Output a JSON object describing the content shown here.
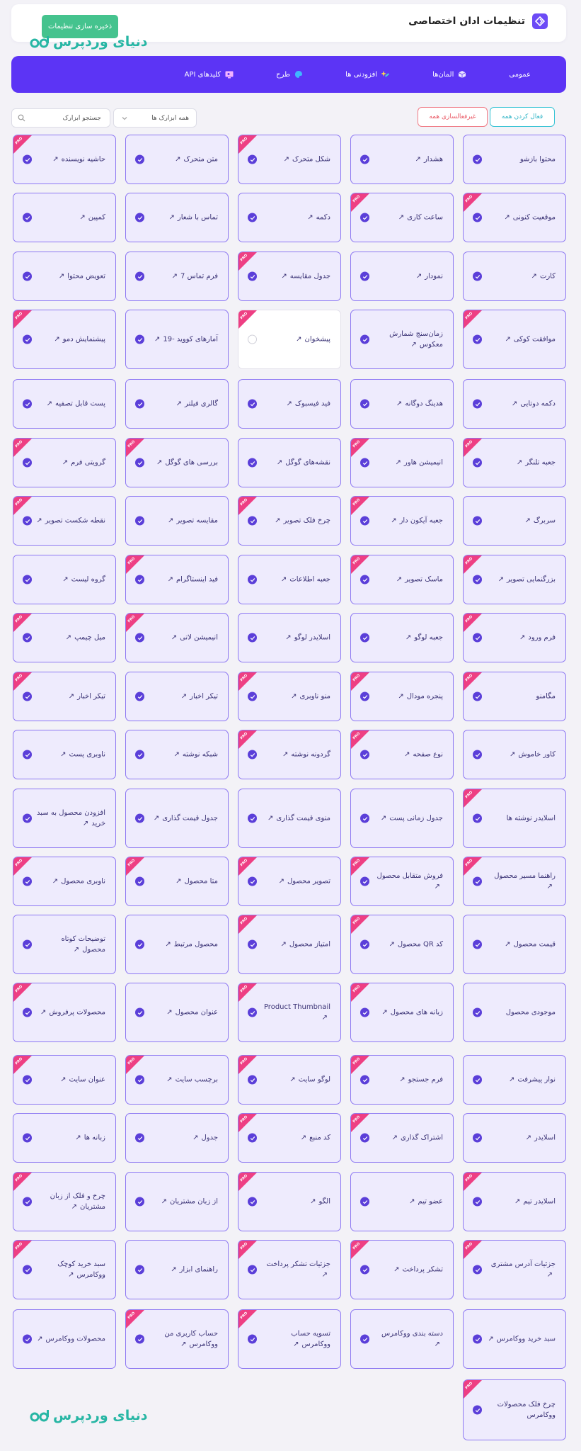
{
  "header": {
    "title": "تنظیمات ادان اختصاصی",
    "save_label": "ذخیره سازی تنظیمات",
    "logo_text": "دنیای وردپرس"
  },
  "nav": {
    "items": [
      {
        "label": "عمومی",
        "icon": "none"
      },
      {
        "label": "المان‌ها",
        "icon": "cube-icon"
      },
      {
        "label": "افزودنی ها",
        "icon": "sparkles-icon"
      },
      {
        "label": "طرح",
        "icon": "palette-icon"
      },
      {
        "label": "کلیدهای API",
        "icon": "key-screen-icon"
      }
    ]
  },
  "toolbar": {
    "enable_all": "فعال کردن همه",
    "disable_all": "غیرفعالسازی همه",
    "filter_selected": "همه ابزارک ها",
    "search_placeholder": "جستجو ابزارک"
  },
  "badge_text": "PRO",
  "colors": {
    "accent": "#5c34f5",
    "save": "#45c38e",
    "pro": "#ee3f83",
    "logo": "#27b6a4"
  },
  "widgets": [
    [
      {
        "label": "محتوا بازشو",
        "ext": false,
        "pro": false,
        "on": true
      },
      {
        "label": "هشدار",
        "ext": true,
        "pro": false,
        "on": true
      },
      {
        "label": "شکل متحرک",
        "ext": true,
        "pro": true,
        "on": true
      },
      {
        "label": "متن متحرک",
        "ext": true,
        "pro": false,
        "on": true
      },
      {
        "label": "حاشیه نویسنده",
        "ext": true,
        "pro": true,
        "on": true
      }
    ],
    [
      {
        "label": "موقعیت کنونی",
        "ext": true,
        "pro": true,
        "on": true
      },
      {
        "label": "ساعت کاری",
        "ext": true,
        "pro": true,
        "on": true
      },
      {
        "label": "دکمه",
        "ext": true,
        "pro": false,
        "on": true
      },
      {
        "label": "تماس با شعار",
        "ext": true,
        "pro": false,
        "on": true
      },
      {
        "label": "کمپین",
        "ext": true,
        "pro": false,
        "on": true
      }
    ],
    [
      {
        "label": "کارت",
        "ext": true,
        "pro": false,
        "on": true
      },
      {
        "label": "نمودار",
        "ext": true,
        "pro": false,
        "on": true
      },
      {
        "label": "جدول مقایسه",
        "ext": true,
        "pro": true,
        "on": true
      },
      {
        "label": "فرم تماس 7",
        "ext": true,
        "pro": false,
        "on": true
      },
      {
        "label": "تعویض محتوا",
        "ext": true,
        "pro": false,
        "on": true
      }
    ],
    [
      {
        "label": "موافقت کوکی",
        "ext": true,
        "pro": true,
        "on": true
      },
      {
        "label": "زمان‌سنج شمارش معکوس",
        "ext": true,
        "pro": false,
        "on": true
      },
      {
        "label": "پیشخوان",
        "ext": true,
        "pro": true,
        "on": false
      },
      {
        "label": "آمارهای کووید -19",
        "ext": true,
        "pro": false,
        "on": true
      },
      {
        "label": "پیشنمایش دمو",
        "ext": true,
        "pro": true,
        "on": true
      }
    ],
    [
      {
        "label": "دکمه دوتایی",
        "ext": true,
        "pro": false,
        "on": true
      },
      {
        "label": "هدینگ دوگانه",
        "ext": true,
        "pro": false,
        "on": true
      },
      {
        "label": "فید فیسبوک",
        "ext": true,
        "pro": false,
        "on": true
      },
      {
        "label": "گالری فیلتر",
        "ext": true,
        "pro": false,
        "on": true
      },
      {
        "label": "پست قابل تصفیه",
        "ext": true,
        "pro": false,
        "on": true
      }
    ],
    [
      {
        "label": "جعبه تلنگر",
        "ext": true,
        "pro": true,
        "on": true
      },
      {
        "label": "انیمیشن هاور",
        "ext": true,
        "pro": true,
        "on": true
      },
      {
        "label": "نقشه‌های گوگل",
        "ext": true,
        "pro": false,
        "on": true
      },
      {
        "label": "بررسی های گوگل",
        "ext": true,
        "pro": true,
        "on": true
      },
      {
        "label": "گرویتی فرم",
        "ext": true,
        "pro": true,
        "on": true
      }
    ],
    [
      {
        "label": "سربرگ",
        "ext": true,
        "pro": false,
        "on": true
      },
      {
        "label": "جعبه آیکون دار",
        "ext": true,
        "pro": true,
        "on": true
      },
      {
        "label": "چرخ فلک تصویر",
        "ext": true,
        "pro": true,
        "on": true
      },
      {
        "label": "مقایسه تصویر",
        "ext": true,
        "pro": false,
        "on": true
      },
      {
        "label": "نقطه شکست تصویر",
        "ext": true,
        "pro": true,
        "on": true
      }
    ],
    [
      {
        "label": "بزرگنمایی تصویر",
        "ext": true,
        "pro": true,
        "on": true
      },
      {
        "label": "ماسک تصویر",
        "ext": true,
        "pro": true,
        "on": true
      },
      {
        "label": "جعبه اطلاعات",
        "ext": true,
        "pro": false,
        "on": true
      },
      {
        "label": "فید اینستاگرام",
        "ext": true,
        "pro": true,
        "on": true
      },
      {
        "label": "گروه لیست",
        "ext": true,
        "pro": false,
        "on": true
      }
    ],
    [
      {
        "label": "فرم ورود",
        "ext": true,
        "pro": true,
        "on": true
      },
      {
        "label": "جعبه لوگو",
        "ext": true,
        "pro": false,
        "on": true
      },
      {
        "label": "اسلایدر لوگو",
        "ext": true,
        "pro": false,
        "on": true
      },
      {
        "label": "انیمیشن لاتی",
        "ext": true,
        "pro": true,
        "on": true
      },
      {
        "label": "میل چیمپ",
        "ext": true,
        "pro": true,
        "on": true
      }
    ],
    [
      {
        "label": "مگامنو",
        "ext": false,
        "pro": true,
        "on": true
      },
      {
        "label": "پنجره مودال",
        "ext": true,
        "pro": true,
        "on": true
      },
      {
        "label": "منو ناوبری",
        "ext": true,
        "pro": true,
        "on": true
      },
      {
        "label": "تیکر اخبار",
        "ext": true,
        "pro": false,
        "on": true
      },
      {
        "label": "تیکر اخبار",
        "ext": true,
        "pro": true,
        "on": true
      }
    ],
    [
      {
        "label": "کاور خاموش",
        "ext": true,
        "pro": false,
        "on": true
      },
      {
        "label": "نوع صفحه",
        "ext": true,
        "pro": true,
        "on": true
      },
      {
        "label": "گردونه نوشته",
        "ext": true,
        "pro": true,
        "on": true
      },
      {
        "label": "شبکه نوشته",
        "ext": true,
        "pro": false,
        "on": true
      },
      {
        "label": "ناوبری پست",
        "ext": true,
        "pro": false,
        "on": true
      }
    ],
    [
      {
        "label": "اسلایدر نوشته ها",
        "ext": false,
        "pro": true,
        "on": true
      },
      {
        "label": "جدول زمانی پست",
        "ext": true,
        "pro": false,
        "on": true
      },
      {
        "label": "منوی قیمت گذاری",
        "ext": true,
        "pro": false,
        "on": true
      },
      {
        "label": "جدول قیمت گذاری",
        "ext": true,
        "pro": false,
        "on": true
      },
      {
        "label": "افزودن محصول به سبد خرید",
        "ext": true,
        "pro": false,
        "on": true
      }
    ],
    [
      {
        "label": "راهنما مسیر محصول",
        "ext": true,
        "pro": true,
        "on": true
      },
      {
        "label": "فروش متقابل محصول",
        "ext": true,
        "pro": true,
        "on": true
      },
      {
        "label": "تصویر محصول",
        "ext": true,
        "pro": true,
        "on": true
      },
      {
        "label": "متا محصول",
        "ext": true,
        "pro": true,
        "on": true
      },
      {
        "label": "ناوبری محصول",
        "ext": true,
        "pro": true,
        "on": true
      }
    ],
    [
      {
        "label": "قیمت محصول",
        "ext": true,
        "pro": false,
        "on": true
      },
      {
        "label": "کد QR محصول",
        "ext": true,
        "pro": true,
        "on": true
      },
      {
        "label": "امتیاز محصول",
        "ext": true,
        "pro": true,
        "on": true
      },
      {
        "label": "محصول مرتبط",
        "ext": true,
        "pro": false,
        "on": true
      },
      {
        "label": "توضیحات کوتاه محصول",
        "ext": true,
        "pro": false,
        "on": true
      }
    ],
    [
      {
        "label": "موجودی محصول",
        "ext": false,
        "pro": false,
        "on": true
      },
      {
        "label": "زبانه های محصول",
        "ext": true,
        "pro": true,
        "on": true
      },
      {
        "label": "Product Thumbnail",
        "ext": true,
        "pro": true,
        "on": true
      },
      {
        "label": "عنوان محصول",
        "ext": true,
        "pro": false,
        "on": true
      },
      {
        "label": "محصولات پرفروش",
        "ext": true,
        "pro": true,
        "on": true
      }
    ],
    [
      {
        "label": "نوار پیشرفت",
        "ext": true,
        "pro": false,
        "on": true
      },
      {
        "label": "فرم جستجو",
        "ext": true,
        "pro": true,
        "on": true
      },
      {
        "label": "لوگو سایت",
        "ext": true,
        "pro": true,
        "on": true
      },
      {
        "label": "برچسب سایت",
        "ext": true,
        "pro": true,
        "on": true
      },
      {
        "label": "عنوان سایت",
        "ext": true,
        "pro": true,
        "on": true
      }
    ],
    [
      {
        "label": "اسلایدر",
        "ext": true,
        "pro": false,
        "on": true
      },
      {
        "label": "اشتراک گذاری",
        "ext": true,
        "pro": true,
        "on": true
      },
      {
        "label": "کد منبع",
        "ext": true,
        "pro": true,
        "on": true
      },
      {
        "label": "جدول",
        "ext": true,
        "pro": false,
        "on": true
      },
      {
        "label": "زبانه ها",
        "ext": true,
        "pro": false,
        "on": true
      }
    ],
    [
      {
        "label": "اسلایدر تیم",
        "ext": true,
        "pro": true,
        "on": true
      },
      {
        "label": "عضو تیم",
        "ext": true,
        "pro": false,
        "on": true
      },
      {
        "label": "الگو",
        "ext": true,
        "pro": true,
        "on": true
      },
      {
        "label": "از زبان مشتریان",
        "ext": true,
        "pro": false,
        "on": true
      },
      {
        "label": "چرخ و فلک از زبان مشتریان",
        "ext": true,
        "pro": true,
        "on": true
      }
    ],
    [
      {
        "label": "جزئیات آدرس مشتری",
        "ext": true,
        "pro": true,
        "on": true
      },
      {
        "label": "تشکر پرداخت",
        "ext": true,
        "pro": true,
        "on": true
      },
      {
        "label": "جزئیات تشکر پرداخت",
        "ext": true,
        "pro": true,
        "on": true
      },
      {
        "label": "راهنمای ابزار",
        "ext": true,
        "pro": false,
        "on": true
      },
      {
        "label": "سبد خرید کوچک ووکامرس",
        "ext": true,
        "pro": true,
        "on": true
      }
    ],
    [
      {
        "label": "سبد خرید ووکامرس",
        "ext": true,
        "pro": false,
        "on": true
      },
      {
        "label": "دسته بندی ووکامرس",
        "ext": true,
        "pro": false,
        "on": true
      },
      {
        "label": "تسویه حساب ووکامرس",
        "ext": true,
        "pro": true,
        "on": true
      },
      {
        "label": "حساب کاربری من ووکامرس",
        "ext": true,
        "pro": true,
        "on": true
      },
      {
        "label": "محصولات ووکامرس",
        "ext": true,
        "pro": false,
        "on": true
      }
    ],
    [
      {
        "label": "چرخ فلک محصولات ووکامرس",
        "ext": false,
        "pro": true,
        "on": true
      }
    ]
  ]
}
